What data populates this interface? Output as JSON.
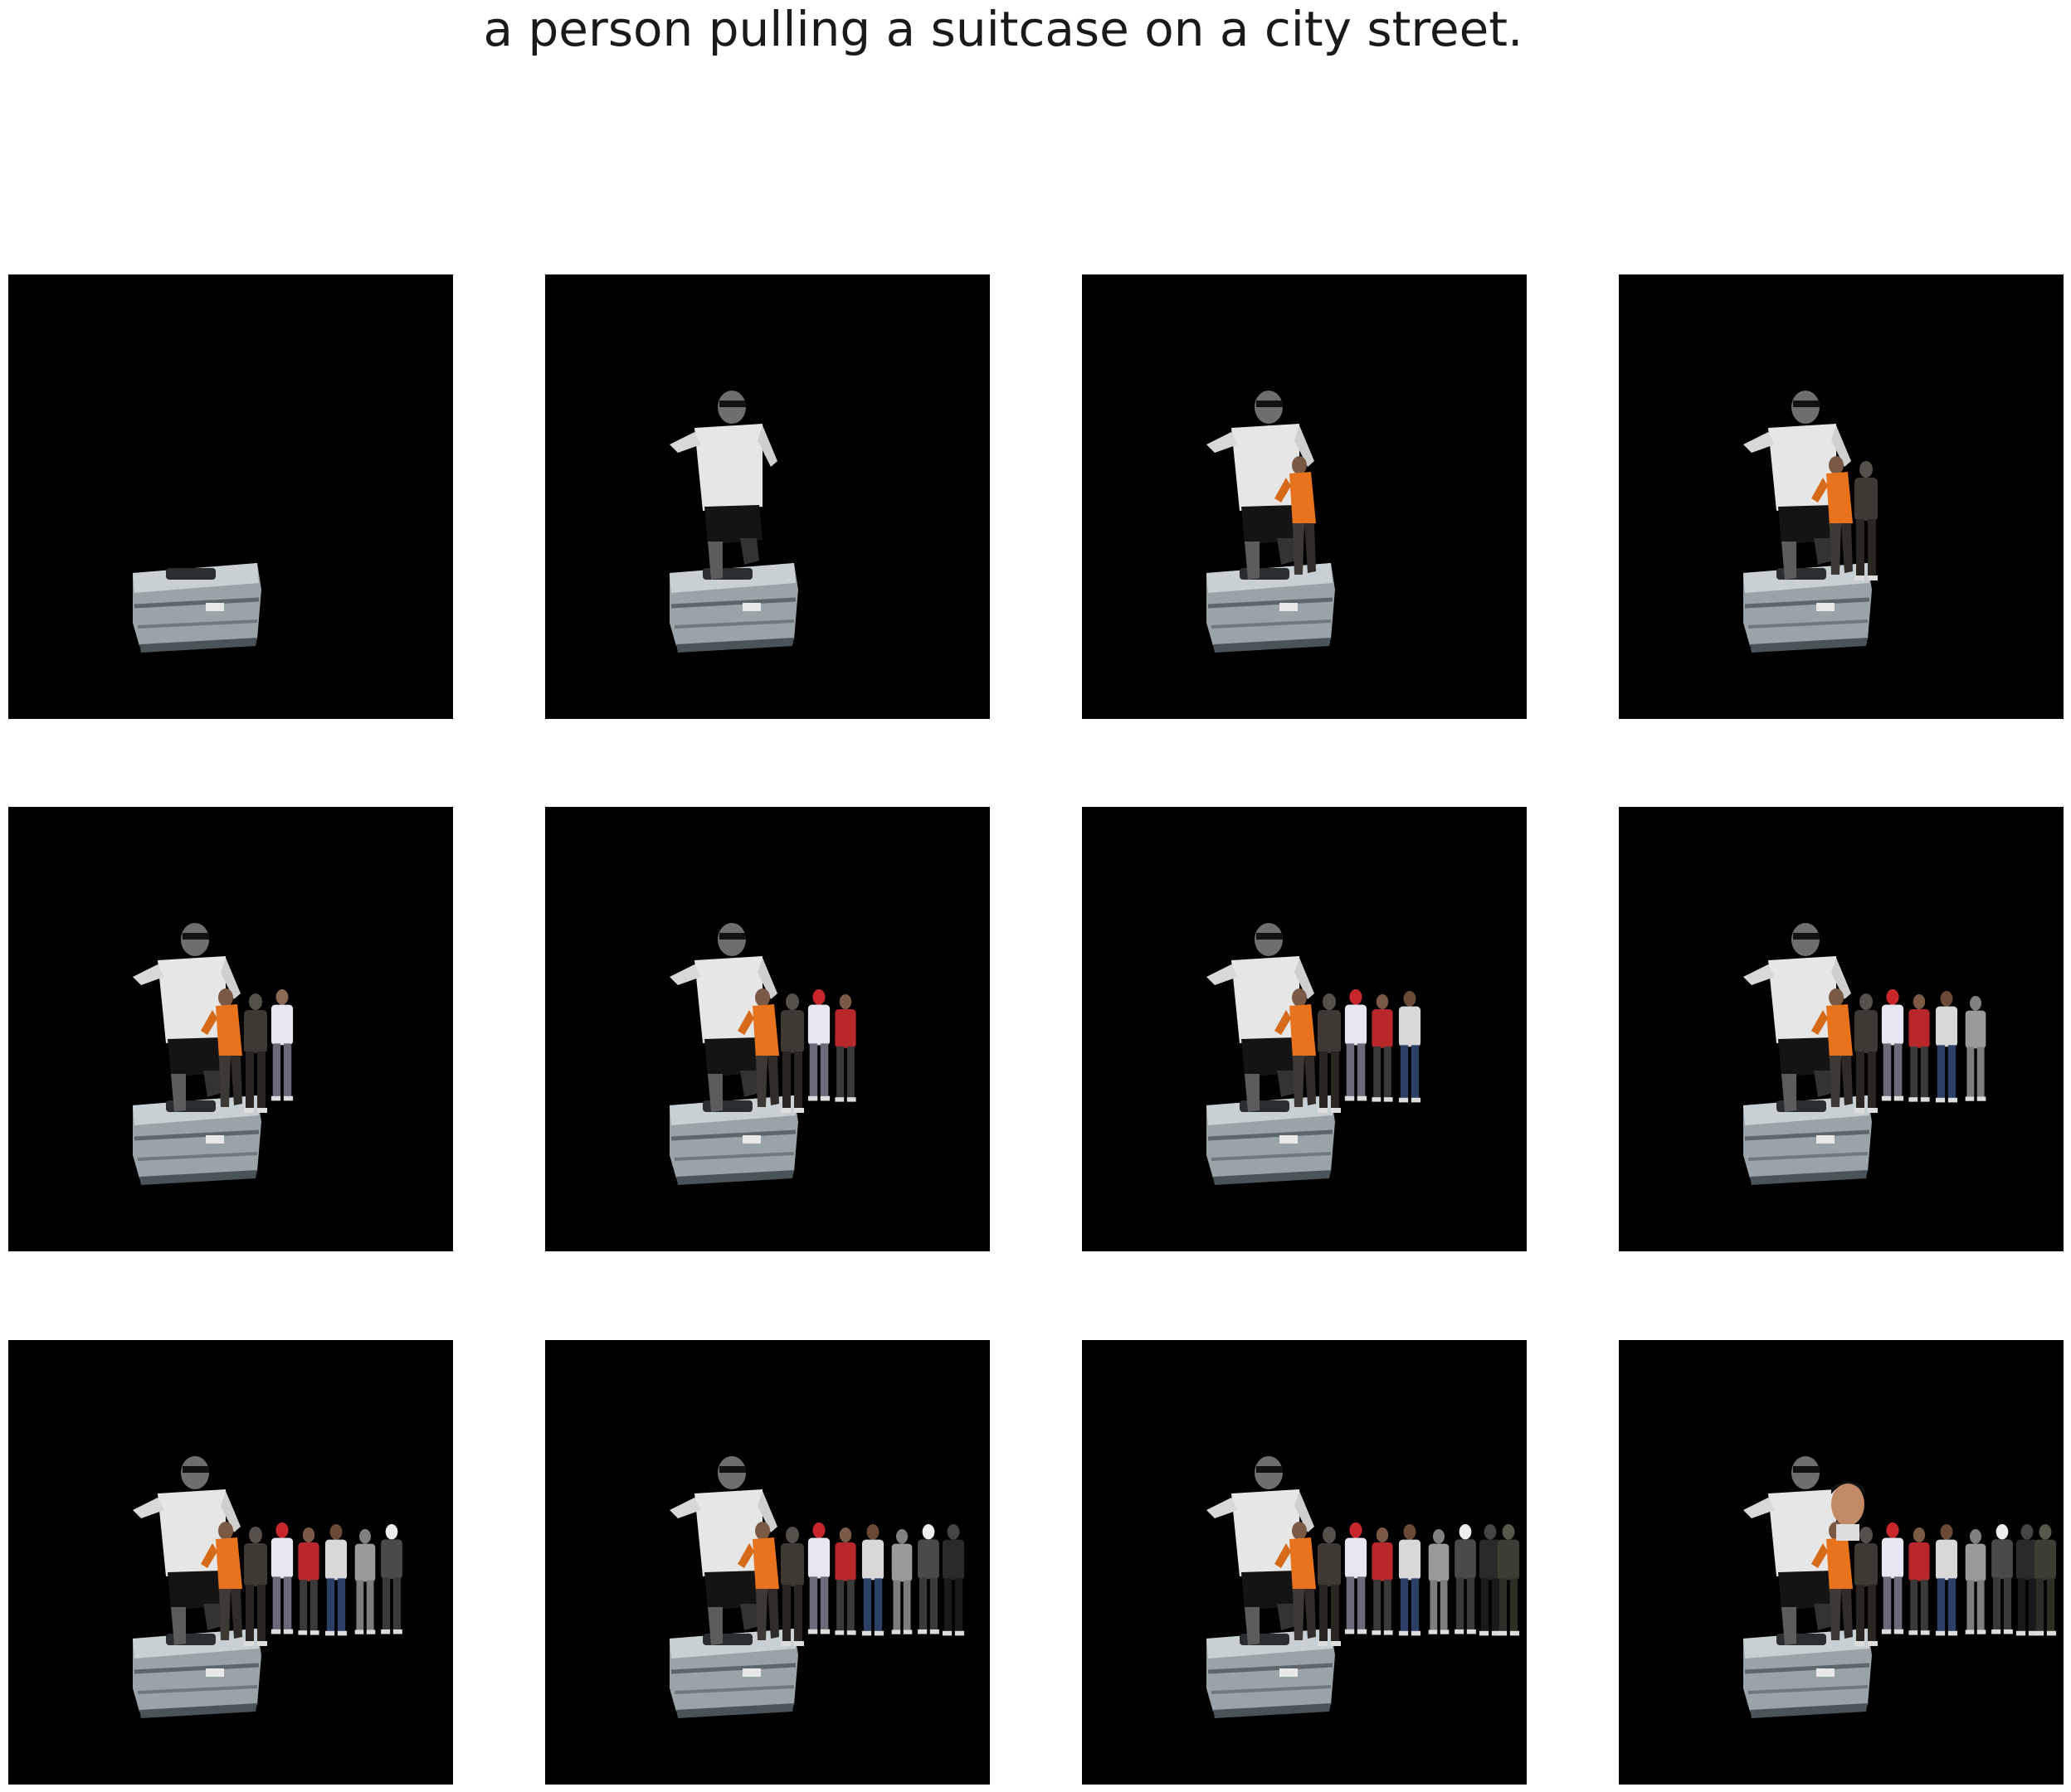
{
  "caption": "a person pulling a suitcase on a city street.",
  "background_color": "#000000",
  "panels": [
    {
      "step": 1,
      "objects": [
        "suitcase"
      ]
    },
    {
      "step": 2,
      "objects": [
        "suitcase",
        "man-white-shirt"
      ]
    },
    {
      "step": 3,
      "objects": [
        "suitcase",
        "man-white-shirt",
        "person-orange"
      ]
    },
    {
      "step": 4,
      "objects": [
        "suitcase",
        "man-white-shirt",
        "person-orange",
        "person-dark-1"
      ]
    },
    {
      "step": 5,
      "objects": [
        "suitcase",
        "man-white-shirt",
        "person-orange",
        "person-dark-1",
        "person-white-top"
      ]
    },
    {
      "step": 6,
      "objects": [
        "suitcase",
        "man-white-shirt",
        "person-orange",
        "person-dark-1",
        "person-white-top",
        "person-red-cap",
        "person-red-shirt"
      ]
    },
    {
      "step": 7,
      "objects": [
        "suitcase",
        "man-white-shirt",
        "person-orange",
        "person-dark-1",
        "person-white-top",
        "person-red-cap",
        "person-red-shirt",
        "person-blue-jeans"
      ]
    },
    {
      "step": 8,
      "objects": [
        "suitcase",
        "man-white-shirt",
        "person-orange",
        "person-dark-1",
        "person-white-top",
        "person-red-cap",
        "person-red-shirt",
        "person-blue-jeans",
        "person-grey-coat"
      ]
    },
    {
      "step": 9,
      "objects": [
        "suitcase",
        "man-white-shirt",
        "person-orange",
        "person-dark-1",
        "person-white-top",
        "person-red-cap",
        "person-red-shirt",
        "person-blue-jeans",
        "person-grey-coat",
        "man-hat-suit"
      ]
    },
    {
      "step": 10,
      "objects": [
        "suitcase",
        "man-white-shirt",
        "person-orange",
        "person-dark-1",
        "person-white-top",
        "person-red-cap",
        "person-red-shirt",
        "person-blue-jeans",
        "person-grey-coat",
        "man-hat-suit",
        "person-dark-2"
      ]
    },
    {
      "step": 11,
      "objects": [
        "suitcase",
        "man-white-shirt",
        "person-orange",
        "person-dark-1",
        "person-white-top",
        "person-red-cap",
        "person-red-shirt",
        "person-blue-jeans",
        "person-grey-coat",
        "man-hat-suit",
        "person-dark-2",
        "person-dark-3"
      ]
    },
    {
      "step": 12,
      "objects": [
        "suitcase",
        "man-white-shirt",
        "person-orange",
        "person-dark-1",
        "person-white-top",
        "person-red-cap",
        "person-red-shirt",
        "person-blue-jeans",
        "person-grey-coat",
        "man-hat-suit",
        "person-dark-2",
        "person-dark-3",
        "boy-face"
      ]
    }
  ]
}
